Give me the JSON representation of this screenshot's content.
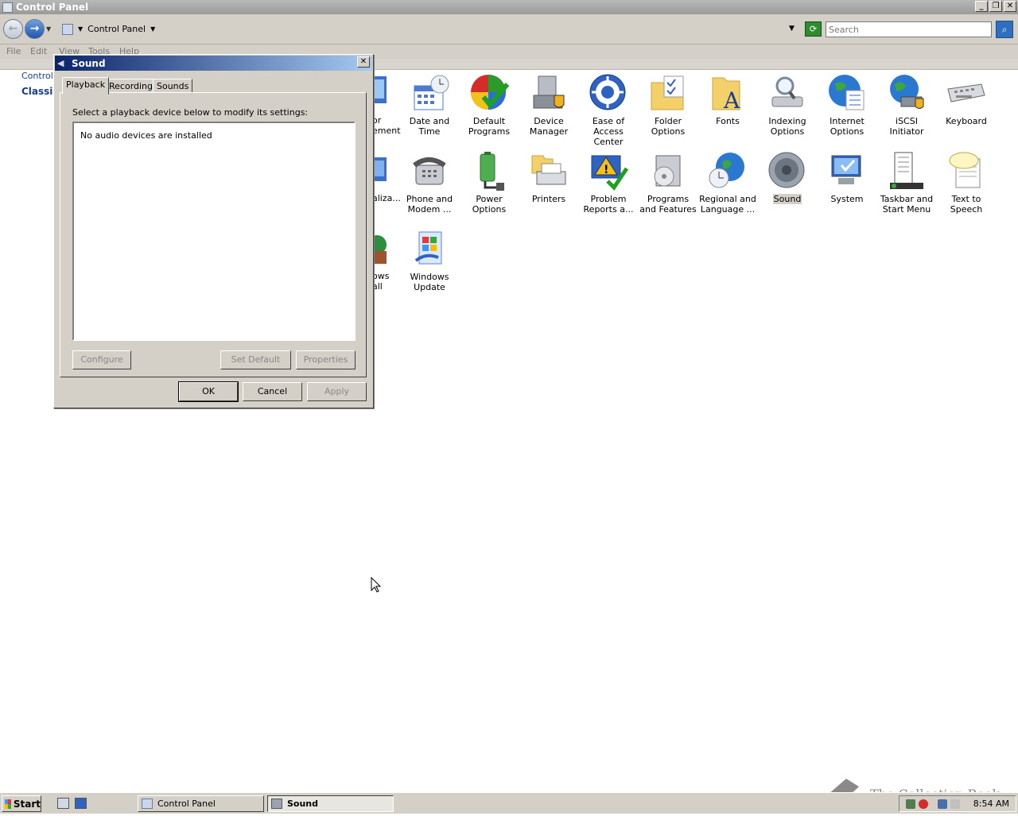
{
  "window": {
    "title": "Control Panel"
  },
  "address": {
    "breadcrumb": "Control Panel",
    "search_placeholder": "Search"
  },
  "menu": [
    "File",
    "Edit",
    "View",
    "Tools",
    "Help"
  ],
  "left_pane": {
    "link1": "Control",
    "link2": "Classic"
  },
  "items_partial": [
    "or",
    "ement",
    "aliza...",
    "ows",
    "all"
  ],
  "items": [
    {
      "label": "Date and Time",
      "icon": "calendar-clock-icon"
    },
    {
      "label": "Default Programs",
      "icon": "default-programs-icon"
    },
    {
      "label": "Device Manager",
      "icon": "device-manager-icon"
    },
    {
      "label": "Ease of Access Center",
      "icon": "ease-of-access-icon"
    },
    {
      "label": "Folder Options",
      "icon": "folder-icon"
    },
    {
      "label": "Fonts",
      "icon": "fonts-folder-icon"
    },
    {
      "label": "Indexing Options",
      "icon": "indexing-icon"
    },
    {
      "label": "Internet Options",
      "icon": "globe-icon"
    },
    {
      "label": "iSCSI Initiator",
      "icon": "iscsi-globe-icon"
    },
    {
      "label": "Keyboard",
      "icon": "keyboard-icon"
    },
    {
      "label": "Phone and Modem ...",
      "icon": "phone-icon"
    },
    {
      "label": "Power Options",
      "icon": "battery-icon"
    },
    {
      "label": "Printers",
      "icon": "printer-icon"
    },
    {
      "label": "Problem Reports a...",
      "icon": "problem-reports-icon"
    },
    {
      "label": "Programs and Features",
      "icon": "programs-icon"
    },
    {
      "label": "Regional and Language ...",
      "icon": "globe-clock-icon"
    },
    {
      "label": "Sound",
      "icon": "speaker-icon"
    },
    {
      "label": "System",
      "icon": "monitor-icon"
    },
    {
      "label": "Taskbar and Start Menu",
      "icon": "taskbar-icon"
    },
    {
      "label": "Text to Speech",
      "icon": "speech-bubble-icon"
    },
    {
      "label": "Windows Update",
      "icon": "windows-update-icon"
    }
  ],
  "dialog": {
    "title": "Sound",
    "tabs": [
      "Playback",
      "Recording",
      "Sounds"
    ],
    "instruction": "Select a playback device below to modify its settings:",
    "empty_message": "No audio devices are installed",
    "buttons": {
      "configure": "Configure",
      "set_default": "Set Default",
      "properties": "Properties",
      "ok": "OK",
      "cancel": "Cancel",
      "apply": "Apply"
    }
  },
  "watermark": "The Collection Book",
  "taskbar": {
    "start": "Start",
    "tasks": [
      "Control Panel",
      "Sound"
    ],
    "clock": "8:54 AM"
  }
}
